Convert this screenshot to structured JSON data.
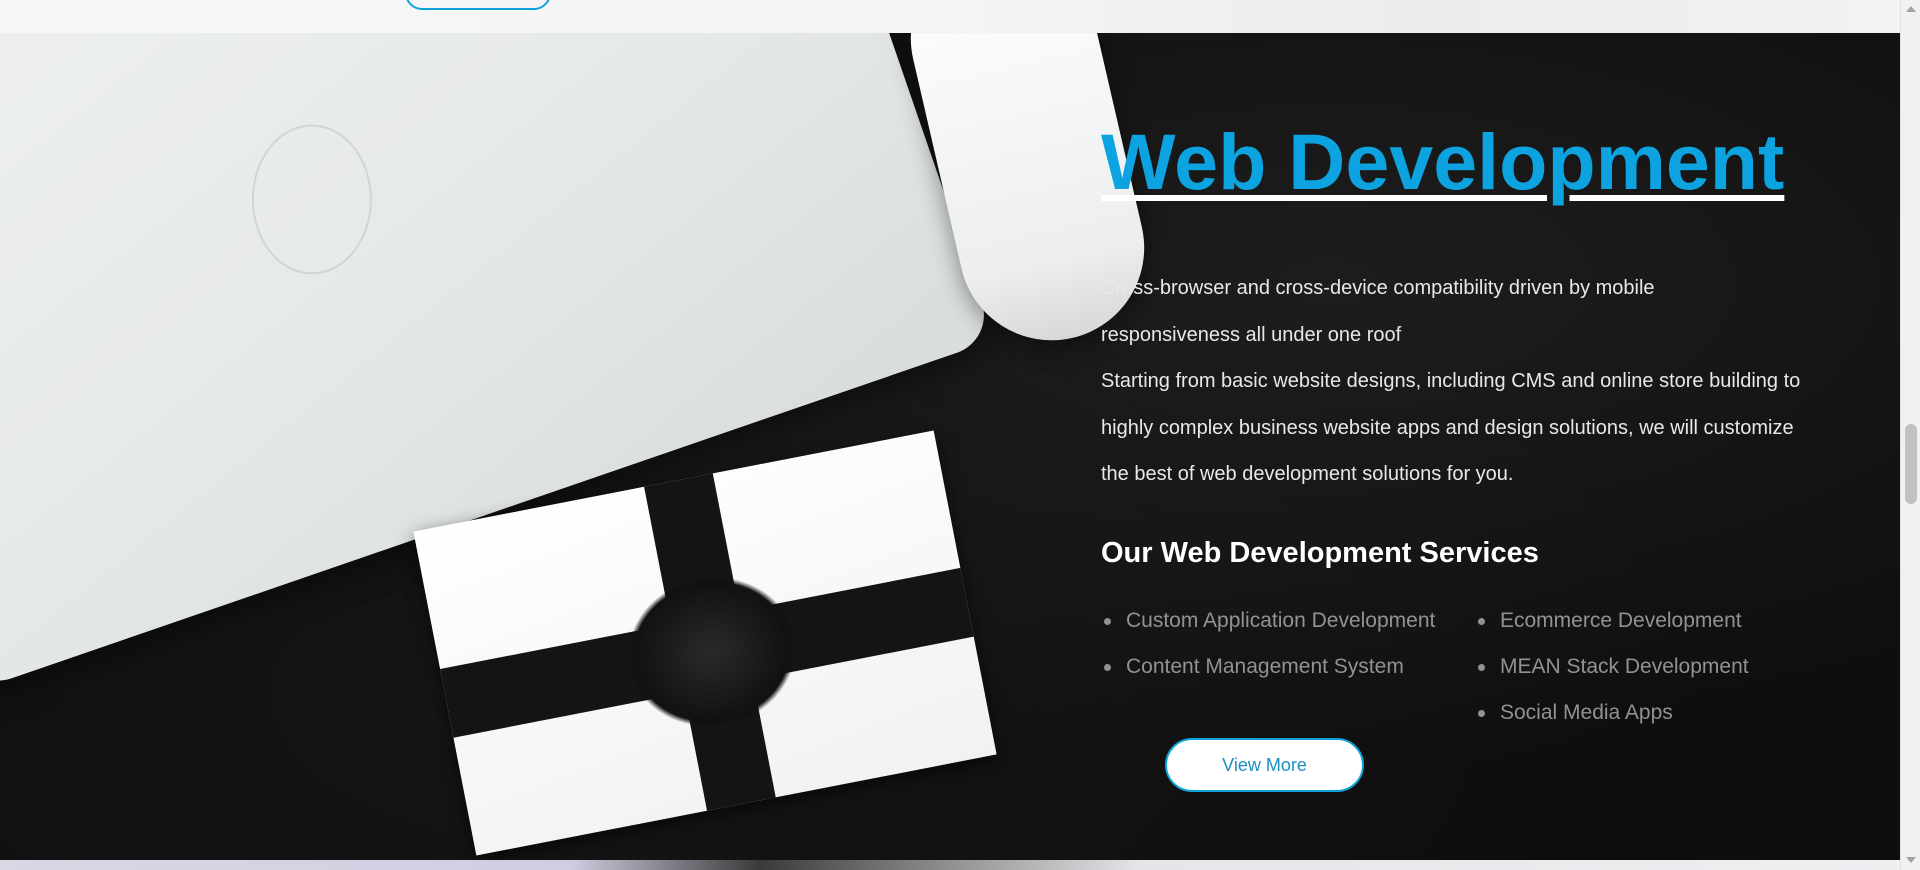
{
  "hero": {
    "title": "Web Development",
    "intro": "Cross-browser and cross-device compatibility driven by mobile responsiveness all under one roof",
    "description": "Starting from basic website designs, including CMS and online store building to highly complex business website apps and design solutions, we will customize the best of web development solutions for you.",
    "services_heading": "Our Web Development Services",
    "services": [
      "Custom Application Development",
      "Content Management System",
      "Ecommerce Development",
      "MEAN Stack Development",
      "Social Media Apps"
    ],
    "cta_label": "View More"
  },
  "colors": {
    "accent": "#0ca3e0",
    "section_background": "#0d0d0d",
    "body_text": "#e8e8e8",
    "list_text": "#8f9396"
  },
  "decorations": [
    "laptop-image",
    "mouse-image",
    "gift-box-image"
  ]
}
